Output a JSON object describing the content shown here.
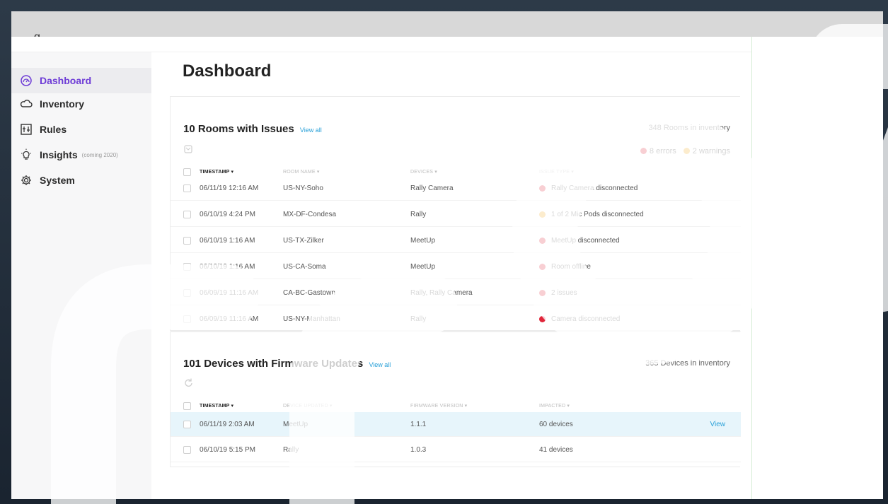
{
  "app": {
    "logo_fragment": "g"
  },
  "sidebar": {
    "items": [
      {
        "label": "Dashboard",
        "icon": "gauge-icon",
        "active": true
      },
      {
        "label": "Inventory",
        "icon": "cloud-icon"
      },
      {
        "label": "Rules",
        "icon": "rules-icon"
      },
      {
        "label": "Insights",
        "icon": "lightbulb-icon",
        "note": "(coming 2020)"
      },
      {
        "label": "System",
        "icon": "gear-icon"
      }
    ]
  },
  "main": {
    "title": "Dashboard"
  },
  "rooms": {
    "title": "10 Rooms with Issues",
    "view_all": "View all",
    "inventory": "348 Rooms in inventory",
    "errors": "8 errors",
    "warnings": "2 warnings",
    "columns": [
      "TIMESTAMP ▾",
      "ROOM NAME ▾",
      "DEVICES ▾",
      "ISSUE TYPE ▾"
    ],
    "rows": [
      {
        "timestamp": "06/11/19 12:16 AM",
        "room": "US-NY-Soho",
        "devices": "Rally Camera",
        "issue": "Rally Camera disconnected",
        "level": "error"
      },
      {
        "timestamp": "06/10/19 4:24 PM",
        "room": "MX-DF-Condesa",
        "devices": "Rally",
        "issue": "1 of 2 Mic Pods disconnected",
        "level": "warning"
      },
      {
        "timestamp": "06/10/19 1:16 AM",
        "room": "US-TX-Zilker",
        "devices": "MeetUp",
        "issue": "MeetUp disconnected",
        "level": "error"
      },
      {
        "timestamp": "06/10/19 1:16 AM",
        "room": "US-CA-Soma",
        "devices": "MeetUp",
        "issue": "Room offline",
        "level": "error"
      },
      {
        "timestamp": "06/09/19 11:16 AM",
        "room": "CA-BC-Gastown",
        "devices": "Rally, Rally Camera",
        "issue": "2 issues",
        "level": "error"
      },
      {
        "timestamp": "06/09/19 11:16 AM",
        "room": "US-NY-Manhattan",
        "devices": "Rally",
        "issue": "Camera disconnected",
        "level": "error"
      }
    ]
  },
  "firmware": {
    "title": "101 Devices with Firmware Updates",
    "view_all": "View all",
    "inventory": "365 Devices in inventory",
    "columns": [
      "TIMESTAMP ▾",
      "DEVICE UPDATED ▾",
      "FIRMWARE VERSION ▾",
      "IMPACTED ▾"
    ],
    "rows": [
      {
        "timestamp": "06/11/19 2:03 AM",
        "device": "MeetUp",
        "version": "1.1.1",
        "impacted": "60 devices",
        "action": "View",
        "highlighted": true
      },
      {
        "timestamp": "06/10/19 5:15 PM",
        "device": "Rally",
        "version": "1.0.3",
        "impacted": "41 devices",
        "action": "",
        "highlighted": false
      }
    ]
  },
  "colors": {
    "accent": "#6d3bd6",
    "link": "#28a0d8",
    "error": "#e0263a",
    "warning": "#f2a81b"
  }
}
